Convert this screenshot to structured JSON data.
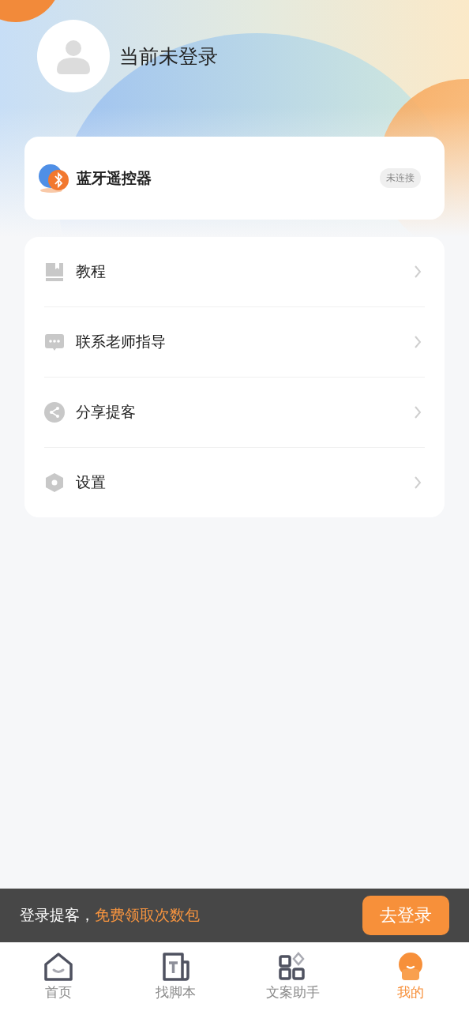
{
  "profile": {
    "status": "当前未登录"
  },
  "device": {
    "name": "蓝牙遥控器",
    "status": "未连接"
  },
  "menu": [
    {
      "label": "教程",
      "kind": "book"
    },
    {
      "label": "联系老师指导",
      "kind": "chat"
    },
    {
      "label": "分享提客",
      "kind": "share"
    },
    {
      "label": "设置",
      "kind": "settings"
    }
  ],
  "login_banner": {
    "text": "登录提客，",
    "highlight": "免费领取次数包",
    "button": "去登录"
  },
  "tabs": [
    {
      "label": "首页",
      "kind": "home",
      "selected": false
    },
    {
      "label": "找脚本",
      "kind": "script",
      "selected": false
    },
    {
      "label": "文案助手",
      "kind": "apps",
      "selected": false
    },
    {
      "label": "我的",
      "kind": "me",
      "selected": true
    }
  ]
}
